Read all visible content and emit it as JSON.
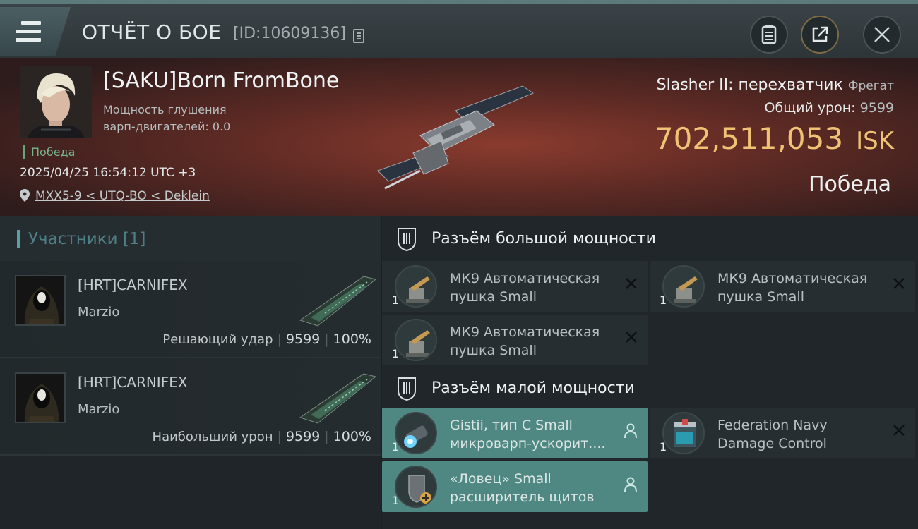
{
  "header": {
    "title": "ОТЧЁТ О БОЕ",
    "report_id": "[ID:10609136]"
  },
  "victim": {
    "name": "[SAKU]Born FromBone",
    "jam_label": "Мощность глушения варп-двигателей: 0.0",
    "status": "Победа",
    "datetime": "2025/04/25 16:54:12 UTC +3",
    "location": "MXX5-9 < UTQ-BO < Deklein",
    "ship_name": "Slasher II: перехватчик",
    "ship_class": "Фрегат",
    "damage_label": "Общий урон:",
    "damage_value": "9599",
    "isk_value": "702,511,053",
    "isk_unit": "ISK",
    "result": "Победа"
  },
  "participants": {
    "header": "Участники [1]",
    "list": [
      {
        "corp": "[HRT]CARNIFEX",
        "name": "Marzio",
        "label": "Решающий удар",
        "damage": "9599",
        "percent": "100%"
      },
      {
        "corp": "[HRT]CARNIFEX",
        "name": "Marzio",
        "label": "Наибольший урон",
        "damage": "9599",
        "percent": "100%"
      }
    ]
  },
  "fitting": {
    "high_slots_title": "Разъём большой мощности",
    "low_slots_title": "Разъём малой мощности",
    "high": [
      {
        "name": "МК9 Автоматическая пушка Small",
        "qty": "1"
      },
      {
        "name": "МК9 Автоматическая пушка Small",
        "qty": "1"
      },
      {
        "name": "МК9 Автоматическая пушка Small",
        "qty": "1"
      }
    ],
    "low": [
      {
        "name": "Gistii, тип C Small микроварп-ускорит....",
        "qty": "1"
      },
      {
        "name": "Federation Navy Damage Control",
        "qty": "1"
      },
      {
        "name": "«Ловец» Small расширитель щитов",
        "qty": "1"
      }
    ]
  },
  "colors": {
    "isk": "#f0c275",
    "victory": "#5fa97a",
    "active_module": "#4f8882"
  }
}
